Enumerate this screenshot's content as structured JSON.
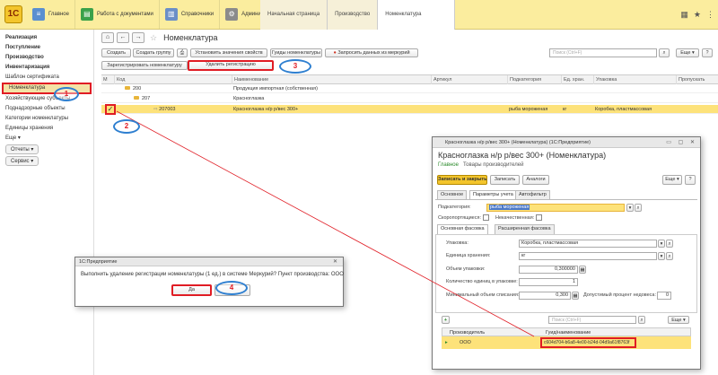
{
  "topbar": {
    "sections": [
      {
        "icon": "home-icon",
        "label": "Главное"
      },
      {
        "icon": "documents-icon",
        "label": "Работа с документами"
      },
      {
        "icon": "book-icon",
        "label": "Справочники"
      },
      {
        "icon": "gear-icon",
        "label": "Администрирование"
      }
    ],
    "open_tabs": [
      "Начальная страница",
      "Производство",
      "Номенклатура"
    ],
    "active_tab_index": 2
  },
  "sidebar": {
    "items": [
      {
        "label": "Реализация",
        "bold": true
      },
      {
        "label": "Поступление",
        "bold": true
      },
      {
        "label": "Производство",
        "bold": true
      },
      {
        "label": "Инвентаризация",
        "bold": true
      },
      {
        "label": "Шаблон сертификата",
        "bold": false
      },
      {
        "label": "Номенклатура",
        "bold": false,
        "selected": true
      },
      {
        "label": "Хозяйствующие субъекты",
        "bold": false
      },
      {
        "label": "Поднадзорные объекты",
        "bold": false
      },
      {
        "label": "Категории номенклатуры",
        "bold": false
      },
      {
        "label": "Единицы хранения",
        "bold": false
      },
      {
        "label": "Еще ▾",
        "bold": false
      }
    ],
    "buttons": [
      "Отчеты ▾",
      "Сервис ▾"
    ]
  },
  "main": {
    "title": "Номенклатура",
    "toolbar": {
      "create": "Создать",
      "create_group": "Создать группу",
      "set_props": "Установить значения свойств",
      "guid": "Гуиды номенклатуры",
      "request_mercury": "Запросить данных из меркурий",
      "register": "Зарегистрировать номенклатуру",
      "delete_reg": "Удалить регистрацию",
      "search_placeholder": "Поиск (Ctrl+F)",
      "more": "Еще ▾",
      "help": "?"
    },
    "columns": [
      "М",
      "Код",
      "Наименование",
      "Артикул",
      "Подкатегория",
      "Ед. хран.",
      "Упаковка",
      "Пропускать"
    ],
    "rows": [
      {
        "code": "200",
        "name": "Продукция импортная (собственная)",
        "level": 0,
        "article": "",
        "subcat": "",
        "unit": "",
        "pack": ""
      },
      {
        "code": "207",
        "name": "Красноглазка",
        "level": 1,
        "article": "",
        "subcat": "",
        "unit": "",
        "pack": ""
      },
      {
        "code": "207003",
        "name": "Красноглазка н/р р/вес 300+",
        "level": 2,
        "article": "",
        "subcat": "рыба мороженая",
        "unit": "кг",
        "pack": "Коробка, пластмассовая",
        "selected": true,
        "check": "✓"
      }
    ]
  },
  "form": {
    "window_title": "Красноглазка н/р р/вес 300+ (Номенклатура) (1С:Предприятие)",
    "header": "Красноглазка н/р р/вес 300+ (Номенклатура)",
    "nav_main": "Главное",
    "nav_producers": "Товары производителей",
    "btn_save_close": "Записать и закрыть",
    "btn_save": "Записать",
    "btn_analogs": "Аналоги",
    "more": "Еще ▾",
    "help": "?",
    "tabs": [
      "Основное",
      "Параметры учета",
      "Автофильтр"
    ],
    "subcategory_label": "Подкатегория:",
    "subcategory_value": "рыба мороженая",
    "perishable_label": "Скоропортящиеся:",
    "defective_label": "Некачественная:",
    "pack_tabs": [
      "Основная фасовка",
      "Расширенная фасовка"
    ],
    "pack_label": "Упаковка:",
    "pack_value": "Коробка, пластмассовая",
    "unit_label": "Единица хранения:",
    "unit_value": "кг",
    "volume_label": "Объем упаковки:",
    "volume_value": "0,300000",
    "qty_label": "Количество единиц в упаковке:",
    "qty_value": "1",
    "minvol_label": "Минимальный объем списания:",
    "minvol_value": "0,300",
    "pct_label": "Допустимый процент недовеса:",
    "pct_value": "0",
    "search_placeholder": "Поиск (Ctrl+F)",
    "tbl_col_producer": "Производитель",
    "tbl_col_guid": "Гуид/наименование",
    "tbl_producer": "ООО",
    "tbl_guid": "c604d704-b6a8-4e00-b24d-04d9a61f8763f"
  },
  "dialog": {
    "title": "1С:Предприятие",
    "message": "Выполнить удаление регистрации номенклатуры (1 ед.) в системе Меркурий? Пункт производства: ООО",
    "ok": "Да"
  },
  "markers": [
    "1",
    "2",
    "3",
    "4"
  ],
  "colors": {
    "topbar": "#fbed9e",
    "selection": "#fde27a",
    "highlight": "#e01c24",
    "marker": "#2e7fd0",
    "primary_button": "#f3c52c"
  }
}
